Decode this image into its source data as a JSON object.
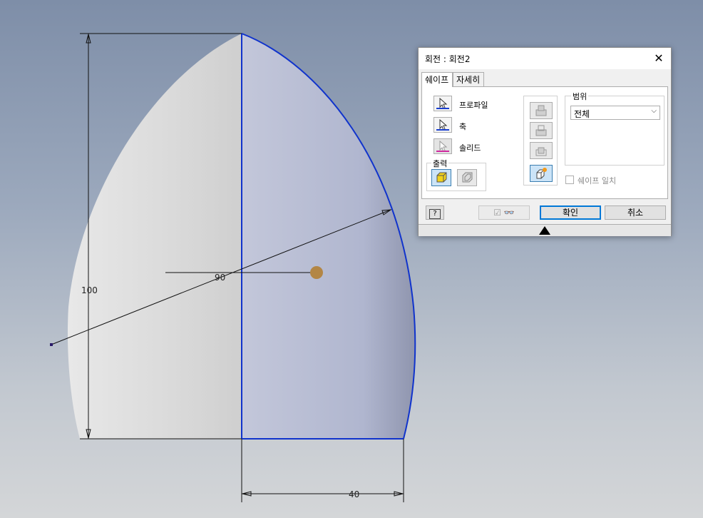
{
  "viewport": {
    "dimensions": {
      "height": "100",
      "angle": "90",
      "width": "40"
    },
    "colors": {
      "profile_line": "#1033cc",
      "body_light": "#e2e2e2",
      "body_blue": "#b7bed6",
      "axis_point": "#b38645"
    }
  },
  "dialog": {
    "title": "회전 : 회전2",
    "close_icon": "close-icon",
    "tabs": [
      {
        "label": "쉐이프",
        "active": true
      },
      {
        "label": "자세히",
        "active": false
      }
    ],
    "selectors": [
      {
        "label": "프로파일",
        "icon": "cursor-icon",
        "underline": "#1a3fd0"
      },
      {
        "label": "축",
        "icon": "cursor-icon",
        "underline": "#1a3fd0"
      },
      {
        "label": "솔리드",
        "icon": "cursor-icon",
        "underline": "#d02aa0"
      }
    ],
    "output": {
      "label": "출력",
      "buttons": [
        {
          "name": "solid-output",
          "icon": "solid-cube-icon",
          "active": true
        },
        {
          "name": "surface-output",
          "icon": "surface-icon",
          "active": false
        }
      ]
    },
    "operations": [
      {
        "name": "join",
        "icon": "join-icon",
        "enabled": false
      },
      {
        "name": "cut",
        "icon": "cut-icon",
        "enabled": false
      },
      {
        "name": "intersect",
        "icon": "intersect-icon",
        "enabled": false
      },
      {
        "name": "new-solid",
        "icon": "new-solid-icon",
        "active": true
      }
    ],
    "extents": {
      "label": "범위",
      "selected": "전체",
      "chevron": "chevron-down-icon"
    },
    "match_shape": {
      "label": "쉐이프 일치",
      "checked": false
    },
    "footer": {
      "help_icon": "help-icon",
      "preview_icon": "glasses-icon",
      "ok_label": "확인",
      "cancel_label": "취소"
    }
  }
}
